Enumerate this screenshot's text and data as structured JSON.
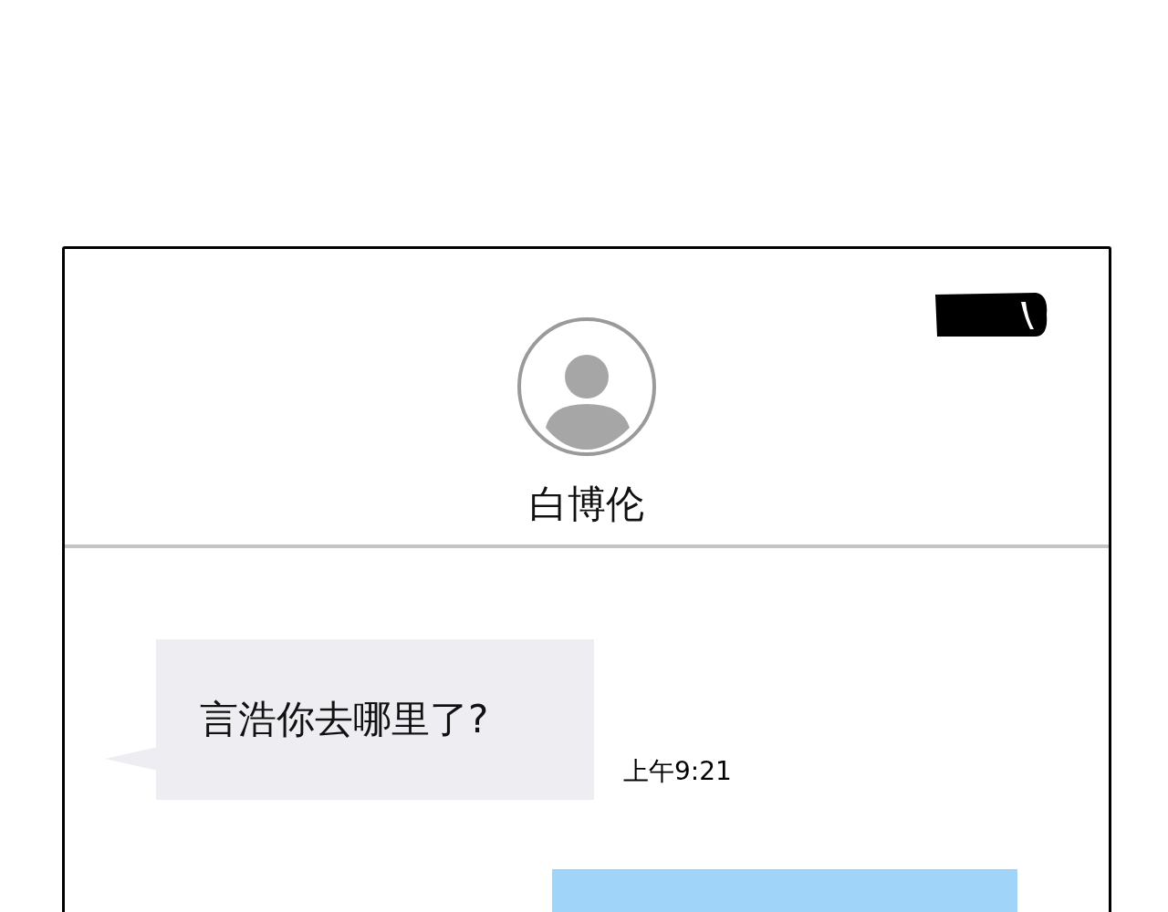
{
  "contact": {
    "name": "白博伦"
  },
  "messages": [
    {
      "kind": "incoming",
      "text": "言浩你去哪里了?",
      "time": "上午9:21"
    },
    {
      "kind": "outgoing"
    }
  ]
}
